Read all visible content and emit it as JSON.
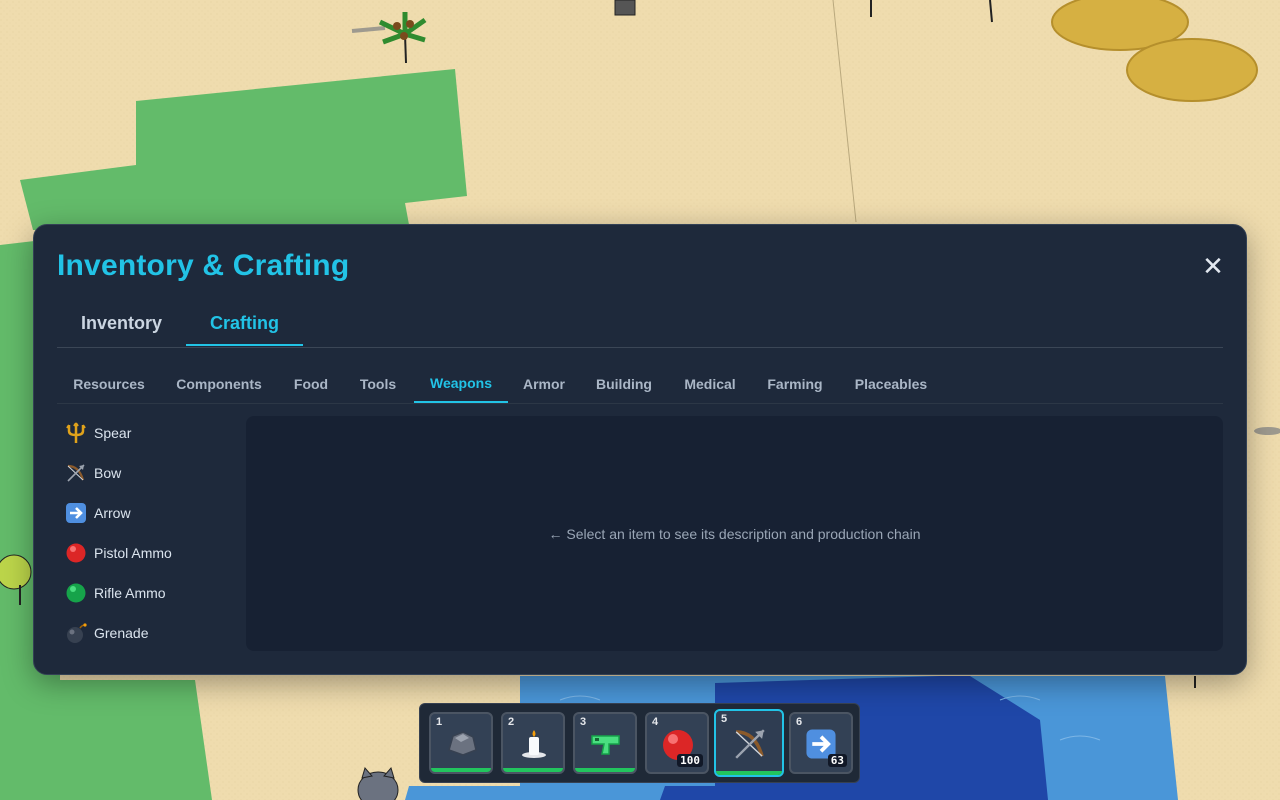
{
  "panel": {
    "title": "Inventory & Crafting",
    "close_icon": "✕"
  },
  "main_tabs": [
    {
      "label": "Inventory",
      "active": false
    },
    {
      "label": "Crafting",
      "active": true
    }
  ],
  "sub_tabs": [
    {
      "label": "Resources"
    },
    {
      "label": "Components"
    },
    {
      "label": "Food"
    },
    {
      "label": "Tools"
    },
    {
      "label": "Weapons",
      "active": true
    },
    {
      "label": "Armor"
    },
    {
      "label": "Building"
    },
    {
      "label": "Medical"
    },
    {
      "label": "Farming"
    },
    {
      "label": "Placeables"
    }
  ],
  "recipes": [
    {
      "label": "Spear",
      "icon": "trident-icon"
    },
    {
      "label": "Bow",
      "icon": "bow-icon"
    },
    {
      "label": "Arrow",
      "icon": "arrow-right-icon"
    },
    {
      "label": "Pistol Ammo",
      "icon": "red-circle-icon"
    },
    {
      "label": "Rifle Ammo",
      "icon": "green-circle-icon"
    },
    {
      "label": "Grenade",
      "icon": "bomb-icon"
    }
  ],
  "detail": {
    "hint": "← Select an item to see its description and production chain"
  },
  "hotbar": [
    {
      "num": "1",
      "icon": "rock-icon",
      "count": "",
      "durability": 1.0
    },
    {
      "num": "2",
      "icon": "candle-icon",
      "count": "",
      "durability": 1.0
    },
    {
      "num": "3",
      "icon": "water-pistol-icon",
      "count": "",
      "durability": 1.0
    },
    {
      "num": "4",
      "icon": "red-circle-icon",
      "count": "100"
    },
    {
      "num": "5",
      "icon": "bow-icon",
      "count": "",
      "durability": 1.0,
      "selected": true
    },
    {
      "num": "6",
      "icon": "arrow-right-icon",
      "count": "63"
    }
  ],
  "colors": {
    "accent": "#22c3e6",
    "panel_bg": "#1e293b",
    "sand": "#ecd9aa",
    "grass": "#63bb6a",
    "water": "#4a90d9",
    "deep_water": "#1f47a8"
  }
}
